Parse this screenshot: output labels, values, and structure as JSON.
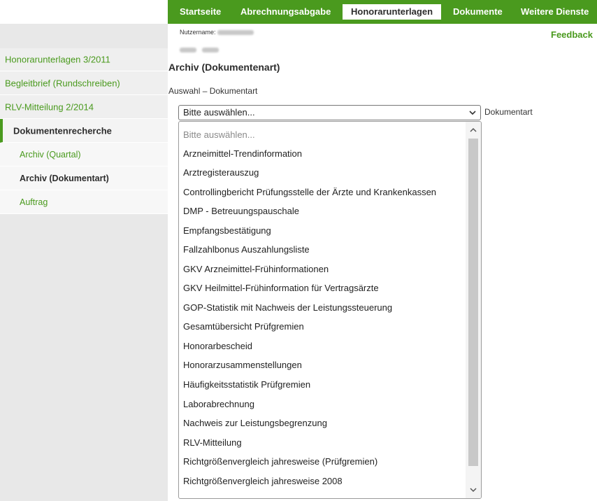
{
  "topnav": {
    "items": [
      {
        "label": "Startseite",
        "active": false
      },
      {
        "label": "Abrechnungsabgabe",
        "active": false
      },
      {
        "label": "Honorarunterlagen",
        "active": true
      },
      {
        "label": "Dokumente",
        "active": false
      },
      {
        "label": "Weitere Dienste",
        "active": false
      }
    ]
  },
  "sidebar": {
    "items": [
      {
        "label": "Honorarunterlagen 3/2011",
        "type": "link"
      },
      {
        "label": "Begleitbrief (Rundschreiben)",
        "type": "link"
      },
      {
        "label": "RLV-Mitteilung 2/2014",
        "type": "link"
      },
      {
        "label": "Dokumentenrecherche",
        "type": "section"
      },
      {
        "label": "Archiv (Quartal)",
        "type": "sub"
      },
      {
        "label": "Archiv (Dokumentart)",
        "type": "sub-current"
      },
      {
        "label": "Auftrag",
        "type": "sub"
      }
    ]
  },
  "header": {
    "username_label": "Nutzername:",
    "feedback_label": "Feedback"
  },
  "main": {
    "title": "Archiv (Dokumentenart)",
    "select_label": "Auswahl – Dokumentart",
    "select_value": "Bitte auswählen...",
    "select_caption": "Dokumentart",
    "options": [
      "Bitte auswählen...",
      "Arzneimittel-Trendinformation",
      "Arztregisterauszug",
      "Controllingbericht Prüfungsstelle der Ärzte und Krankenkassen",
      "DMP - Betreuungspauschale",
      "Empfangsbestätigung",
      "Fallzahlbonus Auszahlungsliste",
      "GKV Arzneimittel-Frühinformationen",
      "GKV Heilmittel-Frühinformation für Vertragsärzte",
      "GOP-Statistik mit Nachweis der Leistungssteuerung",
      "Gesamtübersicht Prüfgremien",
      "Honorarbescheid",
      "Honorarzusammenstellungen",
      "Häufigkeitsstatistik Prüfgremien",
      "Laborabrechnung",
      "Nachweis zur Leistungsbegrenzung",
      "RLV-Mitteilung",
      "Richtgrößenvergleich jahresweise (Prüfgremien)",
      "Richtgrößenvergleich jahresweise 2008"
    ]
  },
  "colors": {
    "brand_green": "#4a9a1e",
    "sidebar_bg": "#e8e8e8"
  },
  "icons": {
    "select_chevron": "chevron-down-icon",
    "scroll_up": "scroll-up-arrow-icon",
    "scroll_down": "scroll-down-arrow-icon"
  }
}
